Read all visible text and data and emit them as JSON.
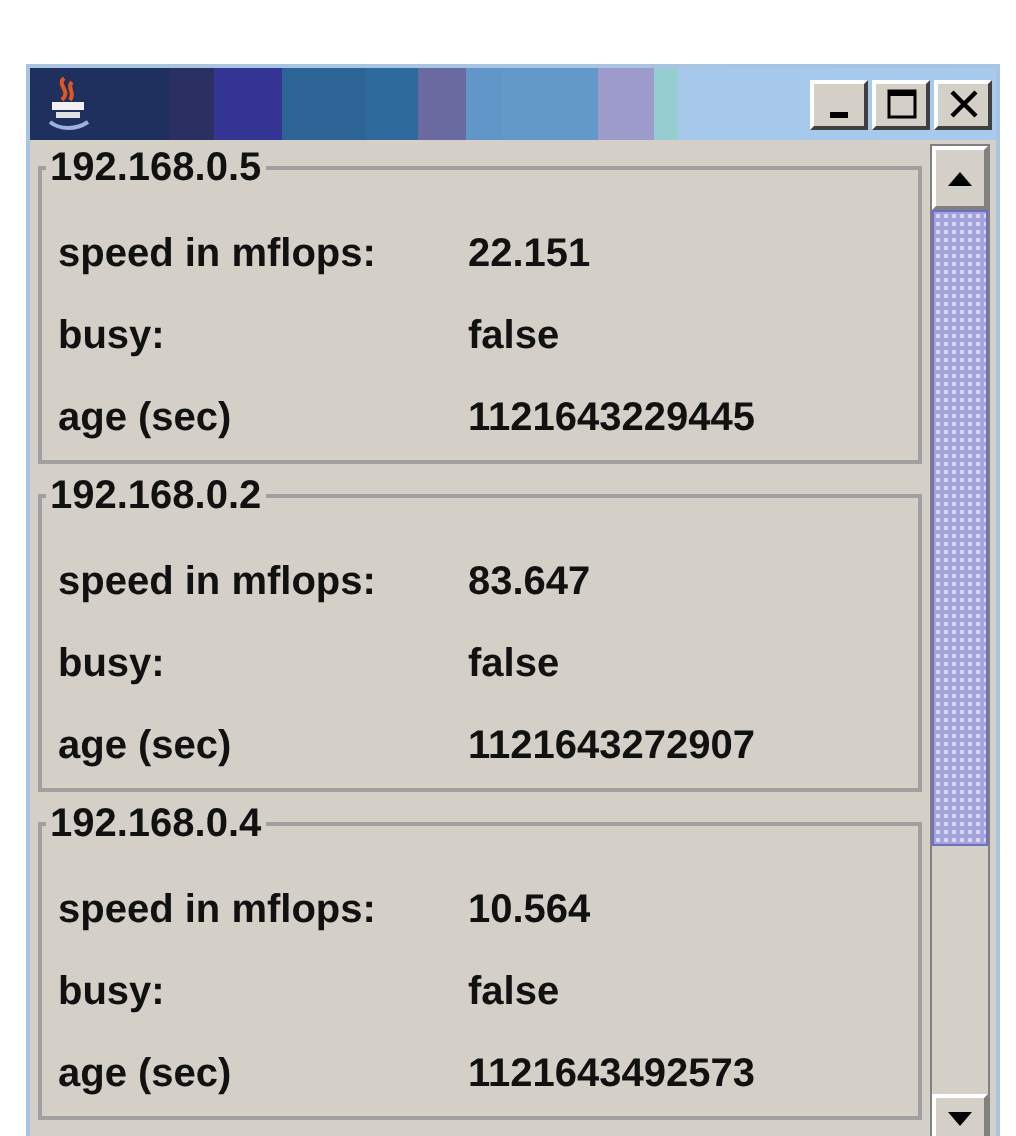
{
  "hosts": [
    {
      "address": "192.168.0.5",
      "fields": [
        {
          "label": "speed in mflops:",
          "value": "22.151"
        },
        {
          "label": "busy:",
          "value": "false"
        },
        {
          "label": "age (sec)",
          "value": "1121643229445"
        }
      ]
    },
    {
      "address": "192.168.0.2",
      "fields": [
        {
          "label": "speed in mflops:",
          "value": "83.647"
        },
        {
          "label": "busy:",
          "value": "false"
        },
        {
          "label": "age (sec)",
          "value": "1121643272907"
        }
      ]
    },
    {
      "address": "192.168.0.4",
      "fields": [
        {
          "label": "speed in mflops:",
          "value": "10.564"
        },
        {
          "label": "busy:",
          "value": "false"
        },
        {
          "label": "age (sec)",
          "value": "1121643492573"
        }
      ]
    }
  ]
}
